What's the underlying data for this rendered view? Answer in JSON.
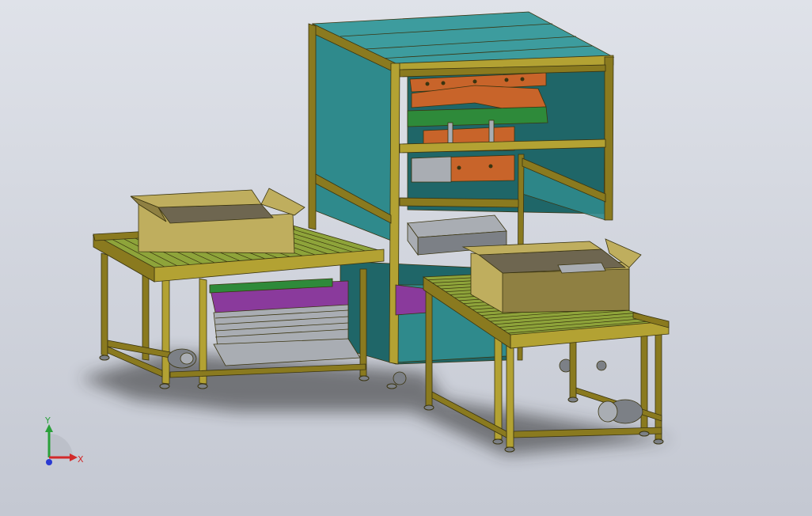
{
  "colors": {
    "background_top": "#dfe2e9",
    "background_bottom": "#c4c8d2",
    "frame": "#8a7a1f",
    "frame_light": "#b3a233",
    "frame_edge": "#3a3410",
    "panel_teal": "#2f8a8c",
    "panel_teal_dark": "#1f6668",
    "roof_teal": "#3d9c9e",
    "box_tan": "#bfae5e",
    "box_tan_dark": "#8f8042",
    "box_inner": "#6e6650",
    "roller_green": "#8ea43a",
    "mechanism_orange": "#c8642a",
    "mechanism_purple": "#8a3a9c",
    "mechanism_green": "#2e8a3a",
    "metal_grey": "#a9adb3",
    "motor_grey": "#7c8086",
    "shadow": "#2a2a2a"
  },
  "axes": {
    "x_label": "X",
    "y_label": "Y",
    "x_color": "#d22a2a",
    "y_color": "#2aa03a",
    "z_color": "#2a3ad2"
  },
  "icons": {
    "triad": "coordinate-triad-icon"
  }
}
